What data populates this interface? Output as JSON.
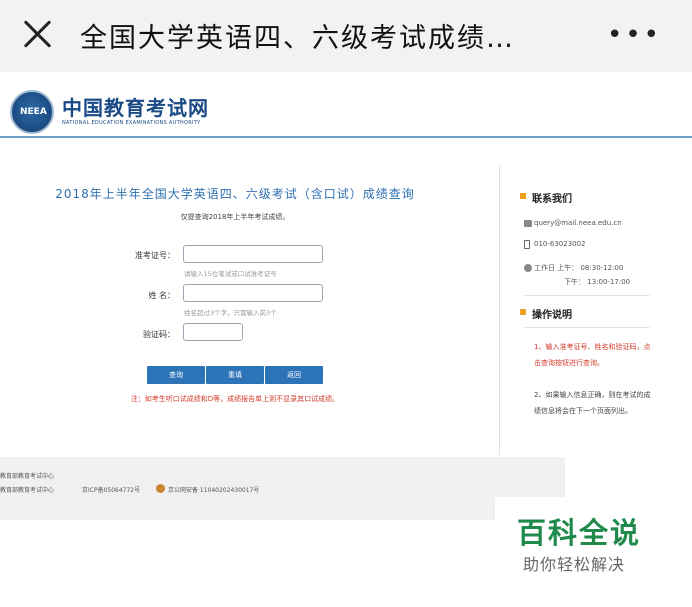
{
  "topbar": {
    "title": "全国大学英语四、六级考试成绩…",
    "more": "•••"
  },
  "brand": {
    "logo_text": "NEEA",
    "name_cn": "中国教育考试网",
    "name_en": "NATIONAL EDUCATION EXAMINATIONS AUTHORITY"
  },
  "query": {
    "title": "2018年上半年全国大学英语四、六级考试（含口试）成绩查询",
    "subtitle": "仅提查询2018年上半年考试成绩。",
    "ticket_label": "准考证号：",
    "ticket_hint": "请输入15位笔试或口试准考证号",
    "name_label": "姓 名：",
    "name_hint": "姓名超过3个字，只需输入前3个",
    "captcha_label": "验证码：",
    "buttons": {
      "query": "查询",
      "reset": "重填",
      "back": "返回"
    },
    "note": "注：如考生听口试成绩和D等，成绩报告单上则不显录其口试成绩。"
  },
  "sidebar": {
    "contact_heading": "联系我们",
    "email": "query@mail.neea.edu.cn",
    "phone": "010-63023002",
    "hours_label": "工作日 上午：",
    "hours_am": "08:30-12:00",
    "hours_pm_label": "下午：",
    "hours_pm": "13:00-17:00",
    "guide_heading": "操作说明",
    "guide_1": "1、输入准考证号、姓名和验证码，点击查询按钮进行查询。",
    "guide_2": "2、如果输入信息正确，则在考试的成绩信息将会在下一个页面列出。"
  },
  "footer": {
    "line_1": "教育部教育考试中心",
    "line_2": "教育部教育考试中心",
    "icp": "京ICP备05064772号",
    "police": "京公网安备 11040202430017号"
  },
  "watermark": {
    "main": "百科全说",
    "sub": "助你轻松解决"
  }
}
